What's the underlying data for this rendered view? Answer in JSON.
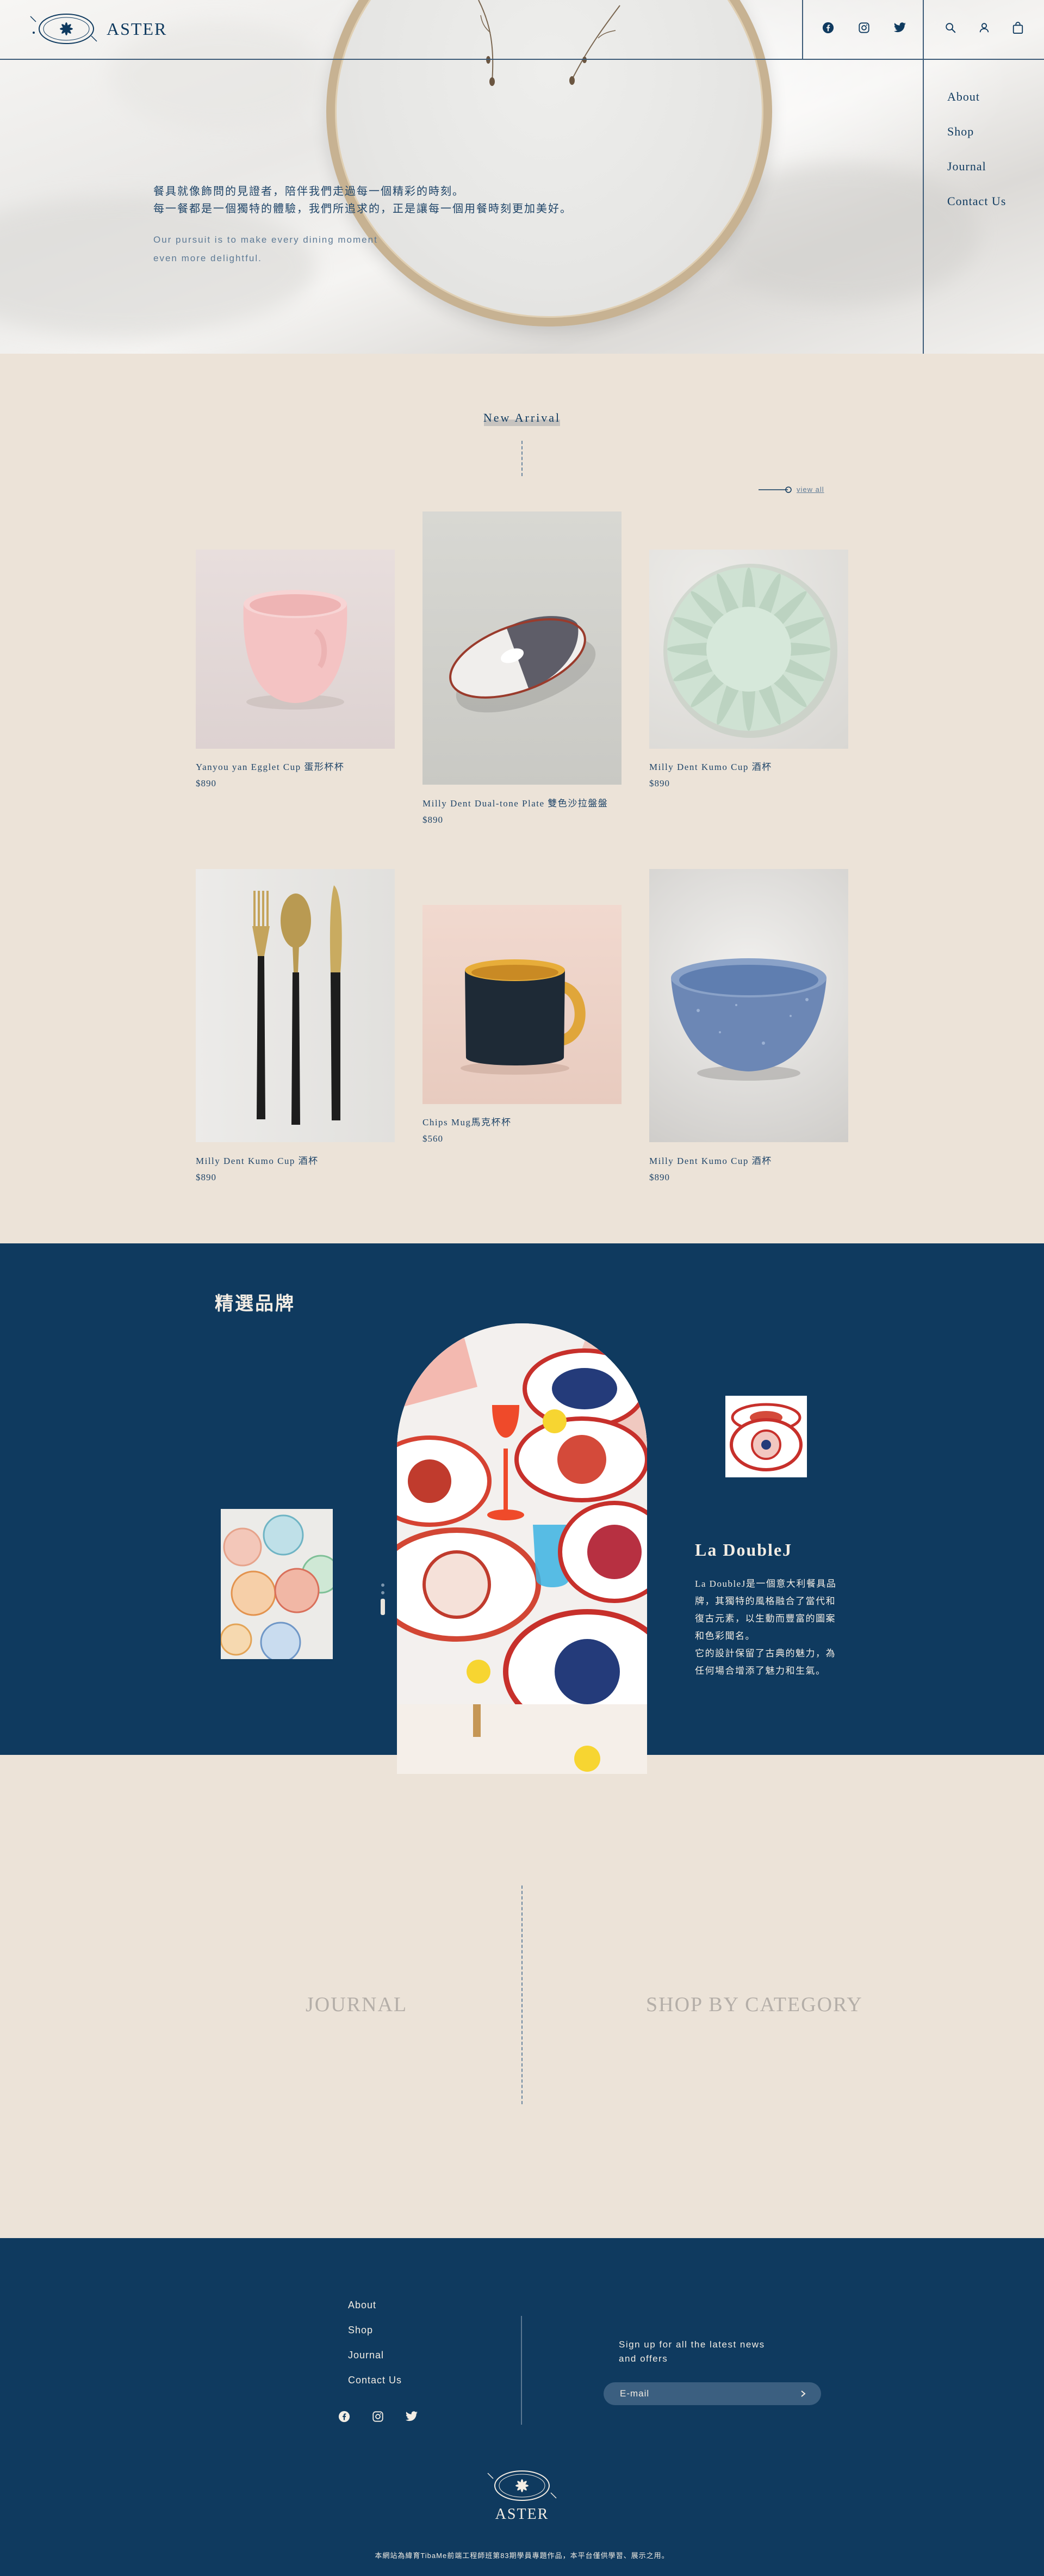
{
  "header": {
    "brand": "ASTER",
    "social": [
      "facebook-icon",
      "instagram-icon",
      "twitter-icon"
    ],
    "tools": [
      "search-icon",
      "user-icon",
      "bag-icon"
    ]
  },
  "hero": {
    "nav": [
      "About",
      "Shop",
      "Journal",
      "Contact Us"
    ],
    "zh_line1": "餐具就像飾問的見證者，陪伴我們走過每一個精彩的時刻。",
    "zh_line2": "每一餐都是一個獨特的體驗，我們所追求的，正是讓每一個用餐時刻更加美好。",
    "en_line1": "Our pursuit is to make every dining moment",
    "en_line2": "even more delightful."
  },
  "new_arrival": {
    "title": "New Arrival",
    "view_all": "view all",
    "products": [
      {
        "name": "Yanyou yan Egglet Cup 蛋形杯杯",
        "price": "$890"
      },
      {
        "name": "Milly Dent Dual-tone Plate 雙色沙拉盤盤",
        "price": "$890"
      },
      {
        "name": "Milly Dent Kumo Cup 酒杯",
        "price": "$890"
      },
      {
        "name": "Milly Dent Kumo Cup 酒杯",
        "price": "$890"
      },
      {
        "name": "Chips Mug馬克杯杯",
        "price": "$560"
      },
      {
        "name": "Milly Dent Kumo Cup 酒杯",
        "price": "$890"
      }
    ]
  },
  "brand": {
    "section_title": "精選品牌",
    "name": "La DoubleJ",
    "desc1": "La DoubleJ是一個意大利餐具品牌，其獨特的風格融合了當代和復古元素，以生動而豐富的圖案和色彩聞名。",
    "desc2": "它的設計保留了古典的魅力，為任何場合增添了魅力和生氣。"
  },
  "links": {
    "journal": "JOURNAL",
    "shop_by_category": "SHOP BY CATEGORY"
  },
  "footer": {
    "nav": [
      "About",
      "Shop",
      "Journal",
      "Contact Us"
    ],
    "signup_line1": "Sign up for all the latest news",
    "signup_line2": "and offers",
    "email_placeholder": "E-mail",
    "brand": "ASTER",
    "copyright": "本網站為緯育TibaMe前端工程師班第83期學員專題作品，本平台僅供學習、展示之用。"
  },
  "colors": {
    "navy": "#0f3a5f",
    "beige": "#ece3d8",
    "cream": "#f3ede4"
  }
}
